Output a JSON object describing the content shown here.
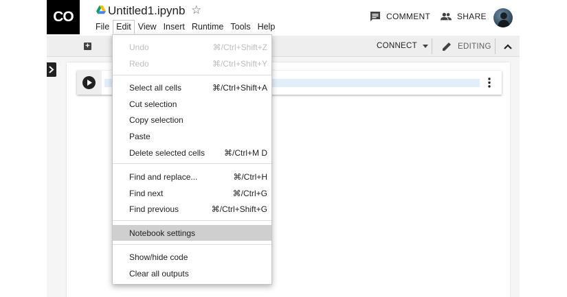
{
  "header": {
    "logo_text": "CO",
    "doc_title": "Untitled1.ipynb",
    "star_glyph": "☆",
    "comment_label": "COMMENT",
    "share_label": "SHARE"
  },
  "menubar": {
    "items": [
      {
        "label": "File"
      },
      {
        "label": "Edit"
      },
      {
        "label": "View"
      },
      {
        "label": "Insert"
      },
      {
        "label": "Runtime"
      },
      {
        "label": "Tools"
      },
      {
        "label": "Help"
      }
    ],
    "active": "Edit"
  },
  "toolbar": {
    "connect_label": "CONNECT",
    "editing_label": "EDITING"
  },
  "edit_menu": {
    "items": [
      {
        "label": "Undo",
        "shortcut": "⌘/Ctrl+Shift+Z",
        "disabled": true
      },
      {
        "label": "Redo",
        "shortcut": "⌘/Ctrl+Shift+Y",
        "disabled": true
      },
      {
        "label": "Select all cells",
        "shortcut": "⌘/Ctrl+Shift+A"
      },
      {
        "label": "Cut selection",
        "shortcut": ""
      },
      {
        "label": "Copy selection",
        "shortcut": ""
      },
      {
        "label": "Paste",
        "shortcut": ""
      },
      {
        "label": "Delete selected cells",
        "shortcut": "⌘/Ctrl+M D"
      },
      {
        "label": "Find and replace...",
        "shortcut": "⌘/Ctrl+H"
      },
      {
        "label": "Find next",
        "shortcut": "⌘/Ctrl+G"
      },
      {
        "label": "Find previous",
        "shortcut": "⌘/Ctrl+Shift+G"
      },
      {
        "label": "Notebook settings",
        "shortcut": "",
        "highlighted": true
      },
      {
        "label": "Show/hide code",
        "shortcut": ""
      },
      {
        "label": "Clear all outputs",
        "shortcut": ""
      }
    ]
  },
  "colors": {
    "logo_bg": "#000000",
    "app_bg": "#f5f5f5",
    "menu_highlight": "#cfcfcf",
    "disabled_text": "#bdbdbd",
    "editor_bg": "#e3eefb"
  },
  "icons": {
    "drive": "google-drive-icon",
    "star": "star-outline-icon",
    "comment": "comment-icon",
    "share": "people-icon",
    "add_cell": "add-box-icon",
    "connect_caret": "caret-down-icon",
    "editing": "pencil-icon",
    "collapse": "chevron-up-icon",
    "sidebar": "chevron-right-icon",
    "run": "play-icon",
    "more": "more-vert-icon"
  }
}
